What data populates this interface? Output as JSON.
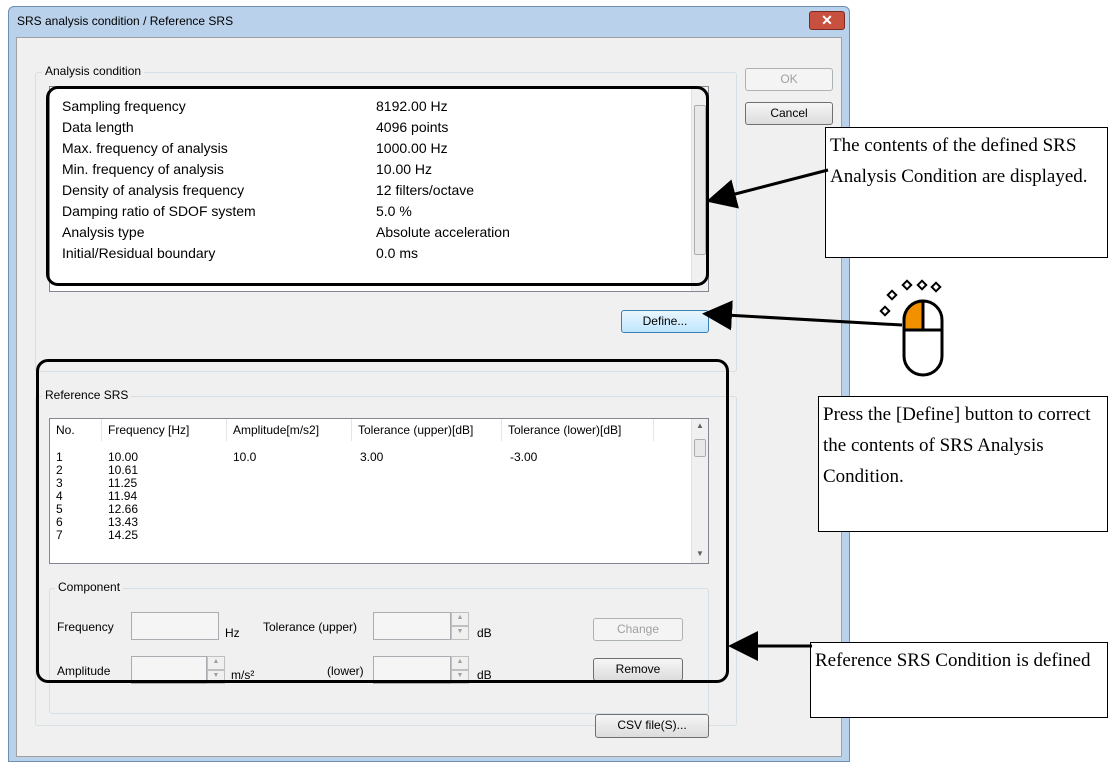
{
  "window": {
    "title": "SRS analysis condition / Reference SRS",
    "close_glyph": "✕"
  },
  "analysis": {
    "group_label": "Analysis condition",
    "rows": [
      {
        "label": "Sampling frequency",
        "value": "8192.00 Hz"
      },
      {
        "label": "Data length",
        "value": "4096 points"
      },
      {
        "label": "Max. frequency of analysis",
        "value": "1000.00 Hz"
      },
      {
        "label": "Min. frequency of analysis",
        "value": "10.00 Hz"
      },
      {
        "label": "Density of analysis frequency",
        "value": "12 filters/octave"
      },
      {
        "label": "Damping ratio of SDOF system",
        "value": "5.0 %"
      },
      {
        "label": "Analysis type",
        "value": "Absolute acceleration"
      },
      {
        "label": "Initial/Residual boundary",
        "value": "0.0 ms"
      }
    ],
    "define_label": "Define..."
  },
  "buttons": {
    "ok": "OK",
    "cancel": "Cancel"
  },
  "reference": {
    "group_label": "Reference SRS",
    "columns": [
      "No.",
      "Frequency [Hz]",
      "Amplitude[m/s2]",
      "Tolerance (upper)[dB]",
      "Tolerance (lower)[dB]"
    ],
    "rows": [
      {
        "no": "1",
        "freq": "10.00",
        "amp": "10.0",
        "tol_upper": "3.00",
        "tol_lower": "-3.00"
      },
      {
        "no": "2",
        "freq": "10.61",
        "amp": "",
        "tol_upper": "",
        "tol_lower": ""
      },
      {
        "no": "3",
        "freq": "11.25",
        "amp": "",
        "tol_upper": "",
        "tol_lower": ""
      },
      {
        "no": "4",
        "freq": "11.94",
        "amp": "",
        "tol_upper": "",
        "tol_lower": ""
      },
      {
        "no": "5",
        "freq": "12.66",
        "amp": "",
        "tol_upper": "",
        "tol_lower": ""
      },
      {
        "no": "6",
        "freq": "13.43",
        "amp": "",
        "tol_upper": "",
        "tol_lower": ""
      },
      {
        "no": "7",
        "freq": "14.25",
        "amp": "",
        "tol_upper": "",
        "tol_lower": ""
      }
    ]
  },
  "component": {
    "group_label": "Component",
    "frequency_label": "Frequency",
    "frequency_unit": "Hz",
    "tol_upper_label": "Tolerance (upper)",
    "tol_upper_unit": "dB",
    "amplitude_label": "Amplitude",
    "amplitude_unit": "m/s²",
    "tol_lower_label": "(lower)",
    "tol_lower_unit": "dB",
    "change_label": "Change",
    "remove_label": "Remove"
  },
  "csv_label": "CSV file(S)...",
  "annotations": {
    "callout1": "The contents of the defined SRS Analysis Condition are displayed.",
    "callout2": "Press the [Define] button to correct the contents of SRS Analysis Condition.",
    "callout3": "Reference SRS Condition is defined"
  },
  "colors": {
    "mouse_button": "#f29100",
    "title_bg": "#b9d1ea",
    "close_btn": "#c7503f"
  }
}
